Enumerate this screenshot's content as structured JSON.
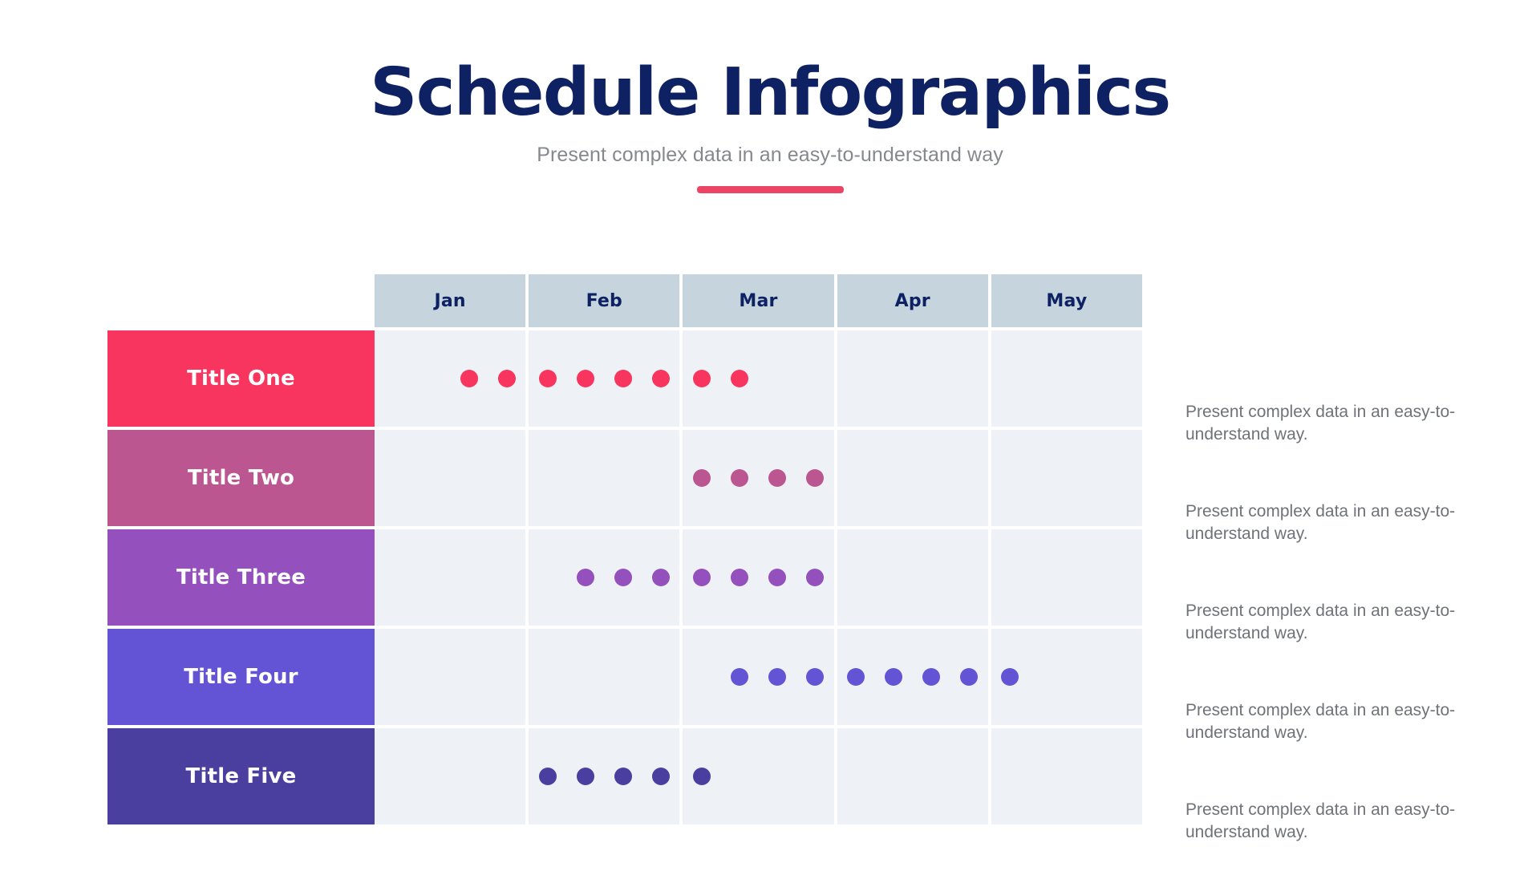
{
  "header": {
    "title": "Schedule Infographics",
    "subtitle": "Present complex data in an easy-to-understand way",
    "divider_color": "#ec4464",
    "title_color": "#0d2163",
    "subtitle_color": "#85888d"
  },
  "table": {
    "header_cell_bg": "#c6d5dd",
    "header_text_color": "#0d2163",
    "track_bg": "#eef2f6",
    "months": [
      "Jan",
      "Feb",
      "Mar",
      "Apr",
      "May"
    ],
    "rows": [
      {
        "label": "Title One",
        "color": "#f8355e",
        "dot_color": "#f8355e",
        "dot_count": 8,
        "start_slot": 2,
        "description": "Present complex data in an easy-to-understand way."
      },
      {
        "label": "Title Two",
        "color": "#bc5690",
        "dot_color": "#bc5690",
        "dot_count": 4,
        "start_slot": 8,
        "description": "Present complex data in an easy-to-understand way."
      },
      {
        "label": "Title Three",
        "color": "#9450bd",
        "dot_color": "#9450bd",
        "dot_count": 7,
        "start_slot": 5,
        "description": "Present complex data in an easy-to-understand way."
      },
      {
        "label": "Title Four",
        "color": "#6254d4",
        "dot_color": "#6254d4",
        "dot_count": 8,
        "start_slot": 9,
        "description": "Present complex data in an easy-to-understand way."
      },
      {
        "label": "Title Five",
        "color": "#4a3f9e",
        "dot_color": "#4a3f9e",
        "dot_count": 5,
        "start_slot": 4,
        "description": "Present complex data in an easy-to-understand way."
      }
    ]
  },
  "chart_data": {
    "type": "table",
    "title": "Schedule Infographics",
    "subtitle": "Present complex data in an easy-to-understand way",
    "categories": [
      "Jan",
      "Feb",
      "Mar",
      "Apr",
      "May"
    ],
    "series": [
      {
        "name": "Title One",
        "dot_count": 8,
        "start_slot": 2,
        "color": "#f8355e"
      },
      {
        "name": "Title Two",
        "dot_count": 4,
        "start_slot": 8,
        "color": "#bc5690"
      },
      {
        "name": "Title Three",
        "dot_count": 7,
        "start_slot": 5,
        "color": "#9450bd"
      },
      {
        "name": "Title Four",
        "dot_count": 8,
        "start_slot": 9,
        "color": "#6254d4"
      },
      {
        "name": "Title Five",
        "dot_count": 5,
        "start_slot": 4,
        "color": "#4a3f9e"
      }
    ],
    "slots_per_month": 4,
    "xlabel": "",
    "ylabel": "",
    "grid": true,
    "legend": "none"
  }
}
